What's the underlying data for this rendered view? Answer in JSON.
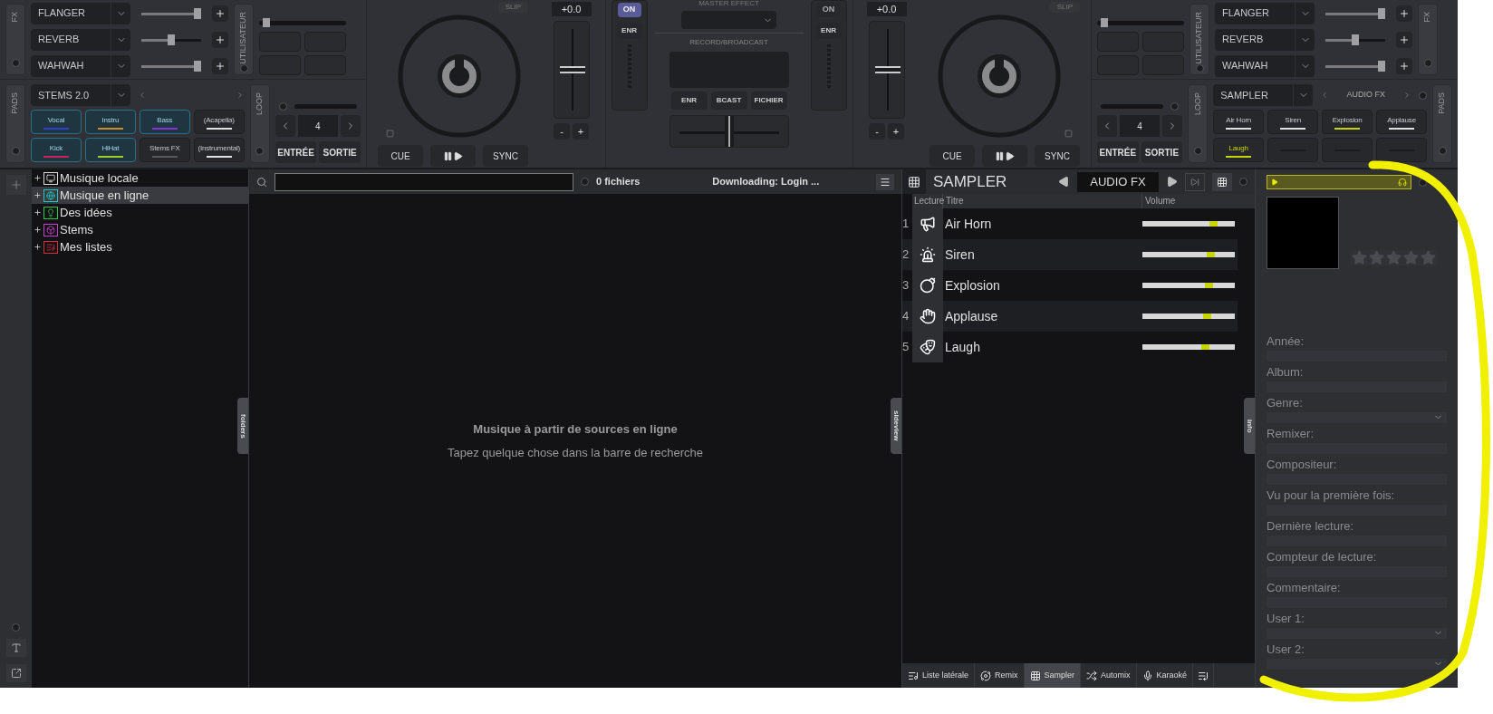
{
  "left_panel": {
    "fx": {
      "label": "FX",
      "effects": [
        {
          "name": "FLANGER",
          "level": 1
        },
        {
          "name": "REVERB",
          "level": 0.5
        },
        {
          "name": "WAHWAH",
          "level": 1
        }
      ]
    },
    "user_label": "UTILISATEUR",
    "user_fader": {
      "level": 0.05
    },
    "pads": {
      "label": "PADS",
      "mode": "STEMS 2.0",
      "buttons": [
        {
          "label": "Vocal",
          "color": "#2f3fd8",
          "selected": true,
          "playing": false
        },
        {
          "label": "Instru",
          "color": "#d0892a",
          "selected": true,
          "playing": false
        },
        {
          "label": "Bass",
          "color": "#8a2fe0",
          "selected": true,
          "playing": false
        },
        {
          "label": "(Acapella)",
          "color": "#e0e0e0",
          "selected": false,
          "playing": false
        },
        {
          "label": "Kick",
          "color": "#c8245a",
          "selected": true,
          "playing": false
        },
        {
          "label": "HiHat",
          "color": "#9ccf2a",
          "selected": true,
          "playing": false
        },
        {
          "label": "Stems FX",
          "color": "#5a5a5e",
          "selected": false,
          "playing": false
        },
        {
          "label": "(Instrumental)",
          "color": "#e0e0e0",
          "selected": false,
          "playing": false
        }
      ]
    },
    "loop": {
      "label": "LOOP",
      "value": "4",
      "in": "ENTRÉE",
      "out": "SORTIE"
    }
  },
  "deck_1": {
    "slip": "SLIP",
    "pitch": {
      "reading": "+0.0",
      "level": 0.5
    },
    "minus": "-",
    "plus": "+",
    "cue": "CUE",
    "sync": "SYNC"
  },
  "mixer": {
    "left": {
      "on": {
        "label": "ON",
        "selected": true
      },
      "rec": "ENR"
    },
    "master_effect": "MASTER EFFECT",
    "record_label": "RECORD/BROADCAST",
    "record_buttons": [
      "ENR",
      "BCAST",
      "FICHIER"
    ],
    "crossfader": {
      "level": 0.5
    },
    "right": {
      "on": {
        "label": "ON",
        "selected": false
      },
      "rec": "ENR"
    }
  },
  "deck_2": {
    "slip": "SLIP",
    "pitch": {
      "reading": "+0.0",
      "level": 0.5
    },
    "minus": "-",
    "plus": "+",
    "cue": "CUE",
    "sync": "SYNC"
  },
  "right_panel": {
    "fx": {
      "label": "FX",
      "effects": [
        {
          "name": "FLANGER",
          "level": 1
        },
        {
          "name": "REVERB",
          "level": 0.5
        },
        {
          "name": "WAHWAH",
          "level": 1
        }
      ]
    },
    "user_label": "UTILISATEUR",
    "user_fader": {
      "level": 0.05
    },
    "pads": {
      "label": "PADS",
      "mode": "SAMPLER",
      "page": "AUDIO FX",
      "buttons": [
        {
          "label": "Air Horn",
          "color": "#e0e0e0",
          "selected": false,
          "playing": false
        },
        {
          "label": "Siren",
          "color": "#e0e0e0",
          "selected": false,
          "playing": false
        },
        {
          "label": "Explosion",
          "color": "#c8d400",
          "selected": false,
          "playing": false
        },
        {
          "label": "Applause",
          "color": "#e0e0e0",
          "selected": false,
          "playing": false
        },
        {
          "label": "Laugh",
          "color": "#c8d400",
          "selected": false,
          "playing": true
        },
        {
          "color": "#1c1c1f",
          "selected": false
        },
        {
          "color": "#1c1c1f",
          "selected": false
        },
        {
          "color": "#1c1c1f",
          "selected": false
        }
      ]
    },
    "loop": {
      "label": "LOOP",
      "value": "4",
      "in": "ENTRÉE",
      "out": "SORTIE"
    }
  },
  "tree": {
    "items": [
      {
        "label": "Musique locale",
        "color": "#d8d8d8",
        "selected": false
      },
      {
        "label": "Musique en ligne",
        "color": "#1fc8c0",
        "selected": true
      },
      {
        "label": "Des idées",
        "color": "#2fc84a",
        "selected": false
      },
      {
        "label": "Stems",
        "color": "#c83fd0",
        "selected": false
      },
      {
        "label": "Mes listes",
        "color": "#d02f3a",
        "selected": false
      }
    ]
  },
  "browser": {
    "file_count": "0 fichiers",
    "status": "Downloading: Login ...",
    "empty_title": "Musique à partir de sources en ligne",
    "empty_hint": "Tapez quelque chose dans la barre de recherche",
    "folders_tab": "folders",
    "sideview_tab": "sideview",
    "info_tab": "info"
  },
  "sampler": {
    "title": "SAMPLER",
    "bank": "AUDIO FX",
    "columns": [
      "Lecture",
      "Titre",
      "Volume"
    ],
    "rows": [
      {
        "number": "1",
        "title": "Air Horn",
        "level": 0.8
      },
      {
        "number": "2",
        "title": "Siren",
        "level": 0.76
      },
      {
        "number": "3",
        "title": "Explosion",
        "level": 0.74
      },
      {
        "number": "4",
        "title": "Applause",
        "level": 0.72
      },
      {
        "number": "5",
        "title": "Laugh",
        "level": 0.7
      }
    ],
    "tabs": [
      {
        "label": "Liste latérale",
        "selected": false
      },
      {
        "label": "Remix",
        "selected": false
      },
      {
        "label": "Sampler",
        "selected": true
      },
      {
        "label": "Automix",
        "selected": false
      },
      {
        "label": "Karaoké",
        "selected": false
      }
    ]
  },
  "info": {
    "stars": 0,
    "fields": [
      {
        "label": "Année:",
        "kind": "text"
      },
      {
        "label": "Album:",
        "kind": "text"
      },
      {
        "label": "Genre:",
        "kind": "dropdown"
      },
      {
        "label": "Remixer:",
        "kind": "text"
      },
      {
        "label": "Compositeur:",
        "kind": "text"
      },
      {
        "label": "Vu pour la première fois:",
        "kind": "text"
      },
      {
        "label": "Dernière lecture:",
        "kind": "text"
      },
      {
        "label": "Compteur de lecture:",
        "kind": "text"
      },
      {
        "label": "Commentaire:",
        "kind": "text"
      },
      {
        "label": "User 1:",
        "kind": "dropdown"
      },
      {
        "label": "User 2:",
        "kind": "dropdown"
      }
    ]
  }
}
